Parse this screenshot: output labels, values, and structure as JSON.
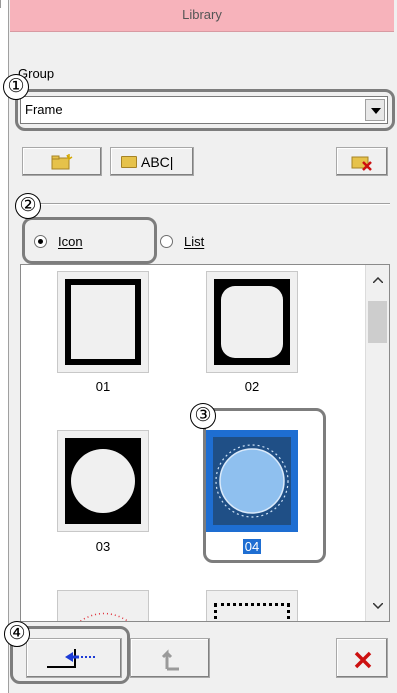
{
  "library": {
    "title": "Library",
    "group_label": "Group",
    "group_value": "Frame",
    "abc_label": "ABC|",
    "view": {
      "icon_label": "Icon",
      "list_label": "List",
      "selected": "Icon"
    },
    "items": [
      {
        "caption": "01"
      },
      {
        "caption": "02"
      },
      {
        "caption": "03"
      },
      {
        "caption": "04",
        "selected": true
      }
    ],
    "callouts": [
      "①",
      "②",
      "③",
      "④"
    ]
  },
  "colors": {
    "title_bg": "#f7b3bb",
    "selection": "#1e6ed2",
    "selected_thumb": "#1f4f86",
    "delete_red": "#cc1010",
    "insert_blue": "#1c3bd6"
  },
  "icons": [
    "new-folder-icon",
    "rename-folder-icon",
    "delete-folder-icon",
    "insert-arrow-icon",
    "up-arrow-icon",
    "close-x-icon"
  ]
}
